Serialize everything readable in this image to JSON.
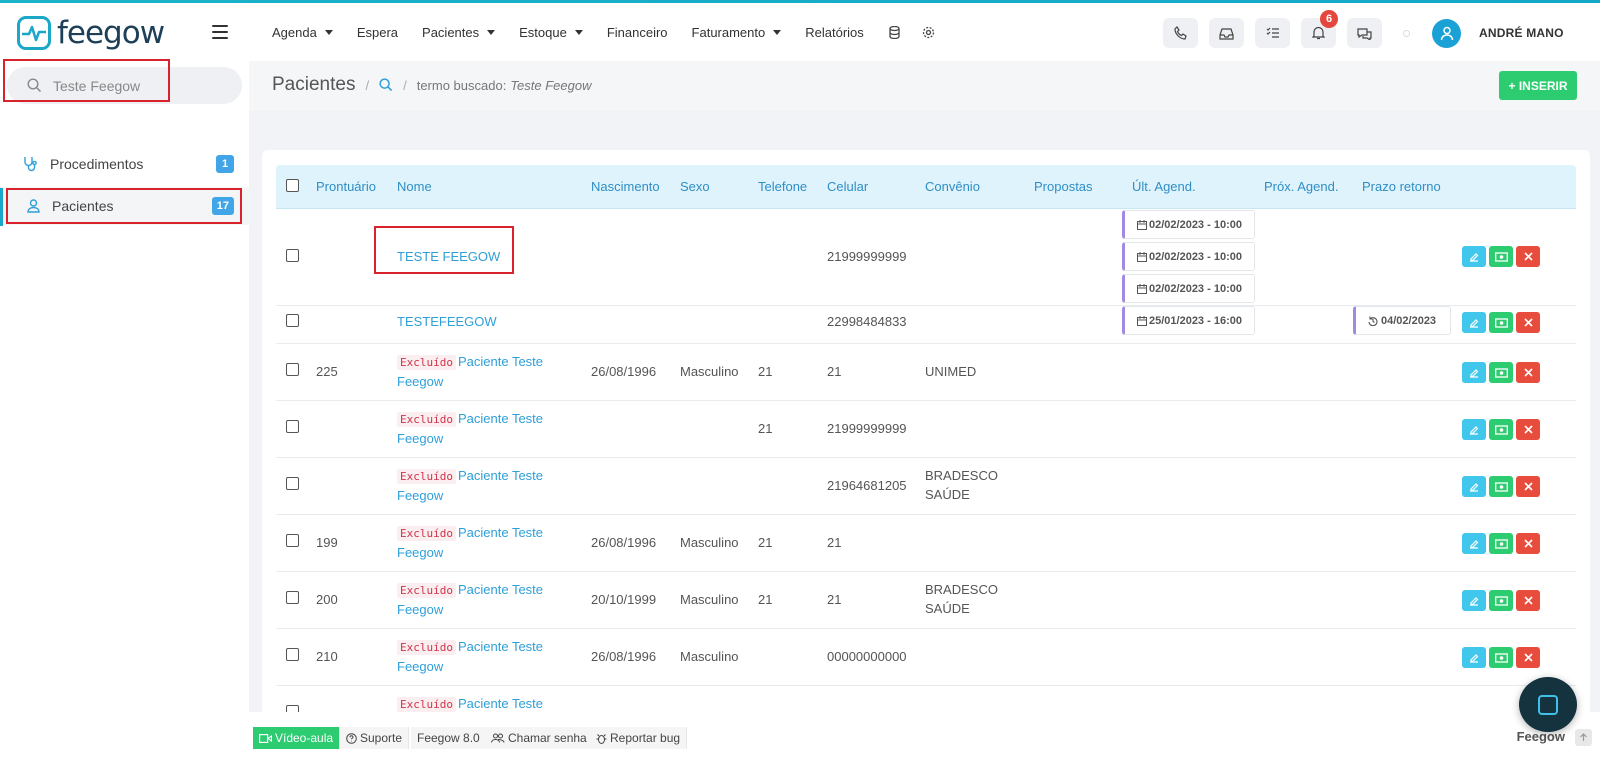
{
  "header": {
    "logo": "feegow",
    "nav": [
      {
        "label": "Agenda",
        "dropdown": true
      },
      {
        "label": "Espera",
        "dropdown": false
      },
      {
        "label": "Pacientes",
        "dropdown": true
      },
      {
        "label": "Estoque",
        "dropdown": true
      },
      {
        "label": "Financeiro",
        "dropdown": false
      },
      {
        "label": "Faturamento",
        "dropdown": true
      },
      {
        "label": "Relatórios",
        "dropdown": false
      }
    ],
    "notifications_count": "6",
    "user": "ANDRÉ MANO"
  },
  "sidebar": {
    "search_value": "Teste Feegow",
    "items": [
      {
        "label": "Procedimentos",
        "count": "1"
      },
      {
        "label": "Pacientes",
        "count": "17"
      }
    ]
  },
  "page": {
    "title": "Pacientes",
    "search_term_label": "termo buscado:",
    "search_term": "Teste Feegow",
    "insert_label": "+ INSERIR"
  },
  "table": {
    "columns": [
      "Prontuário",
      "Nome",
      "Nascimento",
      "Sexo",
      "Telefone",
      "Celular",
      "Convênio",
      "Propostas",
      "Últ. Agend.",
      "Próx. Agend.",
      "Prazo retorno"
    ],
    "rows": [
      {
        "prontuario": "",
        "excluido": "",
        "nome": "TESTE FEEGOW",
        "nome2": "",
        "nascimento": "",
        "sexo": "",
        "telefone": "",
        "celular": "21999999999",
        "convenio": "",
        "convenio2": "",
        "ult": [
          "02/02/2023 - 10:00",
          "02/02/2023 - 10:00",
          "02/02/2023 - 10:00"
        ],
        "prazo": ""
      },
      {
        "prontuario": "",
        "excluido": "",
        "nome": "TESTEFEEGOW",
        "nome2": "",
        "nascimento": "",
        "sexo": "",
        "telefone": "",
        "celular": "22998484833",
        "convenio": "",
        "convenio2": "",
        "ult": [
          "25/01/2023 - 16:00"
        ],
        "prazo": "04/02/2023"
      },
      {
        "prontuario": "225",
        "excluido": "Excluído",
        "nome": "Paciente Teste",
        "nome2": "Feegow",
        "nascimento": "26/08/1996",
        "sexo": "Masculino",
        "telefone": "21",
        "celular": "21",
        "convenio": "UNIMED",
        "convenio2": "",
        "ult": [],
        "prazo": ""
      },
      {
        "prontuario": "",
        "excluido": "Excluído",
        "nome": "Paciente Teste",
        "nome2": "Feegow",
        "nascimento": "",
        "sexo": "",
        "telefone": "21",
        "celular": "21999999999",
        "convenio": "",
        "convenio2": "",
        "ult": [],
        "prazo": ""
      },
      {
        "prontuario": "",
        "excluido": "Excluído",
        "nome": "Paciente Teste",
        "nome2": "Feegow",
        "nascimento": "",
        "sexo": "",
        "telefone": "",
        "celular": "21964681205",
        "convenio": "BRADESCO",
        "convenio2": "SAÚDE",
        "ult": [],
        "prazo": ""
      },
      {
        "prontuario": "199",
        "excluido": "Excluído",
        "nome": "Paciente Teste",
        "nome2": "Feegow",
        "nascimento": "26/08/1996",
        "sexo": "Masculino",
        "telefone": "21",
        "celular": "21",
        "convenio": "",
        "convenio2": "",
        "ult": [],
        "prazo": ""
      },
      {
        "prontuario": "200",
        "excluido": "Excluído",
        "nome": "Paciente Teste",
        "nome2": "Feegow",
        "nascimento": "20/10/1999",
        "sexo": "Masculino",
        "telefone": "21",
        "celular": "21",
        "convenio": "BRADESCO",
        "convenio2": "SAÚDE",
        "ult": [],
        "prazo": ""
      },
      {
        "prontuario": "210",
        "excluido": "Excluído",
        "nome": "Paciente Teste",
        "nome2": "Feegow",
        "nascimento": "26/08/1996",
        "sexo": "Masculino",
        "telefone": "",
        "celular": "00000000000",
        "convenio": "",
        "convenio2": "",
        "ult": [],
        "prazo": ""
      },
      {
        "prontuario": "",
        "excluido": "Excluído",
        "nome": "Paciente Teste",
        "nome2": "",
        "nascimento": "",
        "sexo": "",
        "telefone": "",
        "celular": "",
        "convenio": "",
        "convenio2": "",
        "ult": [],
        "prazo": ""
      }
    ]
  },
  "footer": {
    "video": "Vídeo-aula",
    "suporte": "Suporte",
    "version": "Feegow 8.0",
    "chamar": "Chamar senha",
    "bug": "Reportar bug",
    "brand": "Feegow"
  }
}
